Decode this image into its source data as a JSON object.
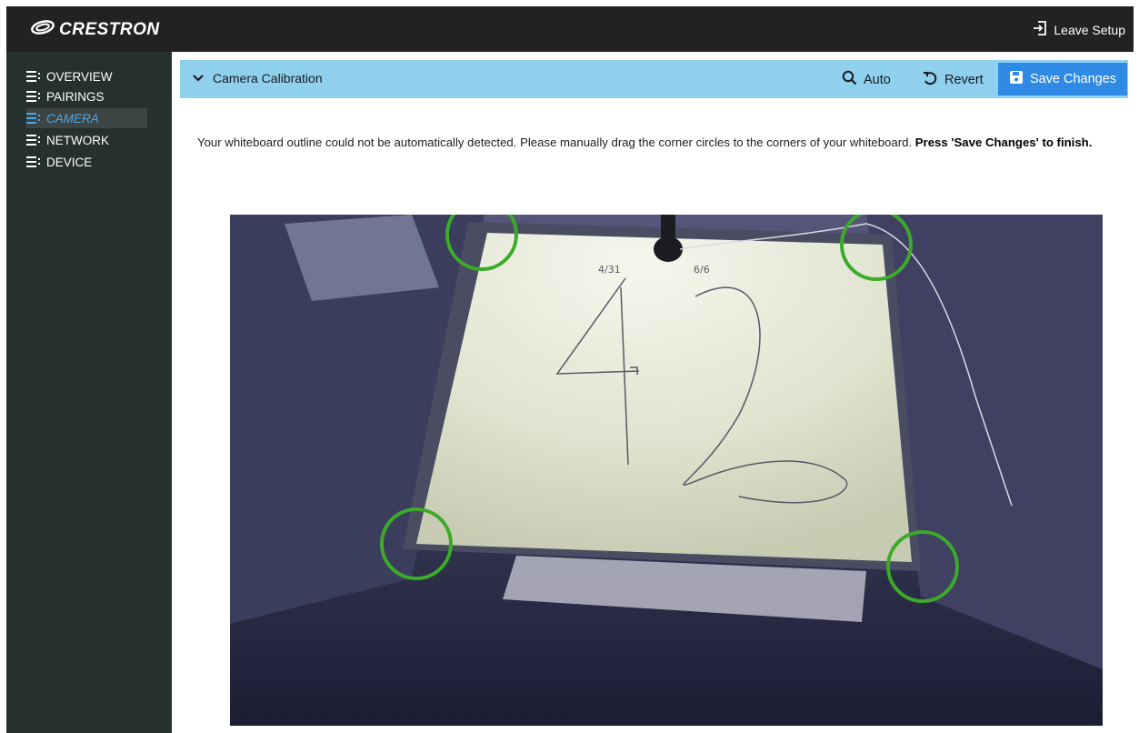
{
  "app": {
    "brand": "CRESTRON",
    "leave_label": "Leave Setup"
  },
  "sidebar": {
    "items": [
      {
        "label": "OVERVIEW",
        "active": false
      },
      {
        "label": "PAIRINGS",
        "active": false
      },
      {
        "label": "CAMERA",
        "active": true
      },
      {
        "label": "NETWORK",
        "active": false
      },
      {
        "label": "DEVICE",
        "active": false
      }
    ]
  },
  "calibration": {
    "title": "Camera Calibration",
    "auto_label": "Auto",
    "revert_label": "Revert",
    "save_label": "Save Changes",
    "instruction_text": "Your whiteboard outline could not be automatically detected. Please manually drag the corner circles to the corners of your whiteboard.",
    "instruction_bold": "Press 'Save Changes' to finish."
  },
  "camera_view": {
    "board_writing": [
      "4/31",
      "6/6",
      "42"
    ]
  },
  "colors": {
    "topbar": "#222222",
    "sidebar": "#26312f",
    "active_item": "#4da6e6",
    "calib_bar": "#8fd0ee",
    "save_button": "#2f8ae6",
    "handle": "#3caa2a"
  }
}
